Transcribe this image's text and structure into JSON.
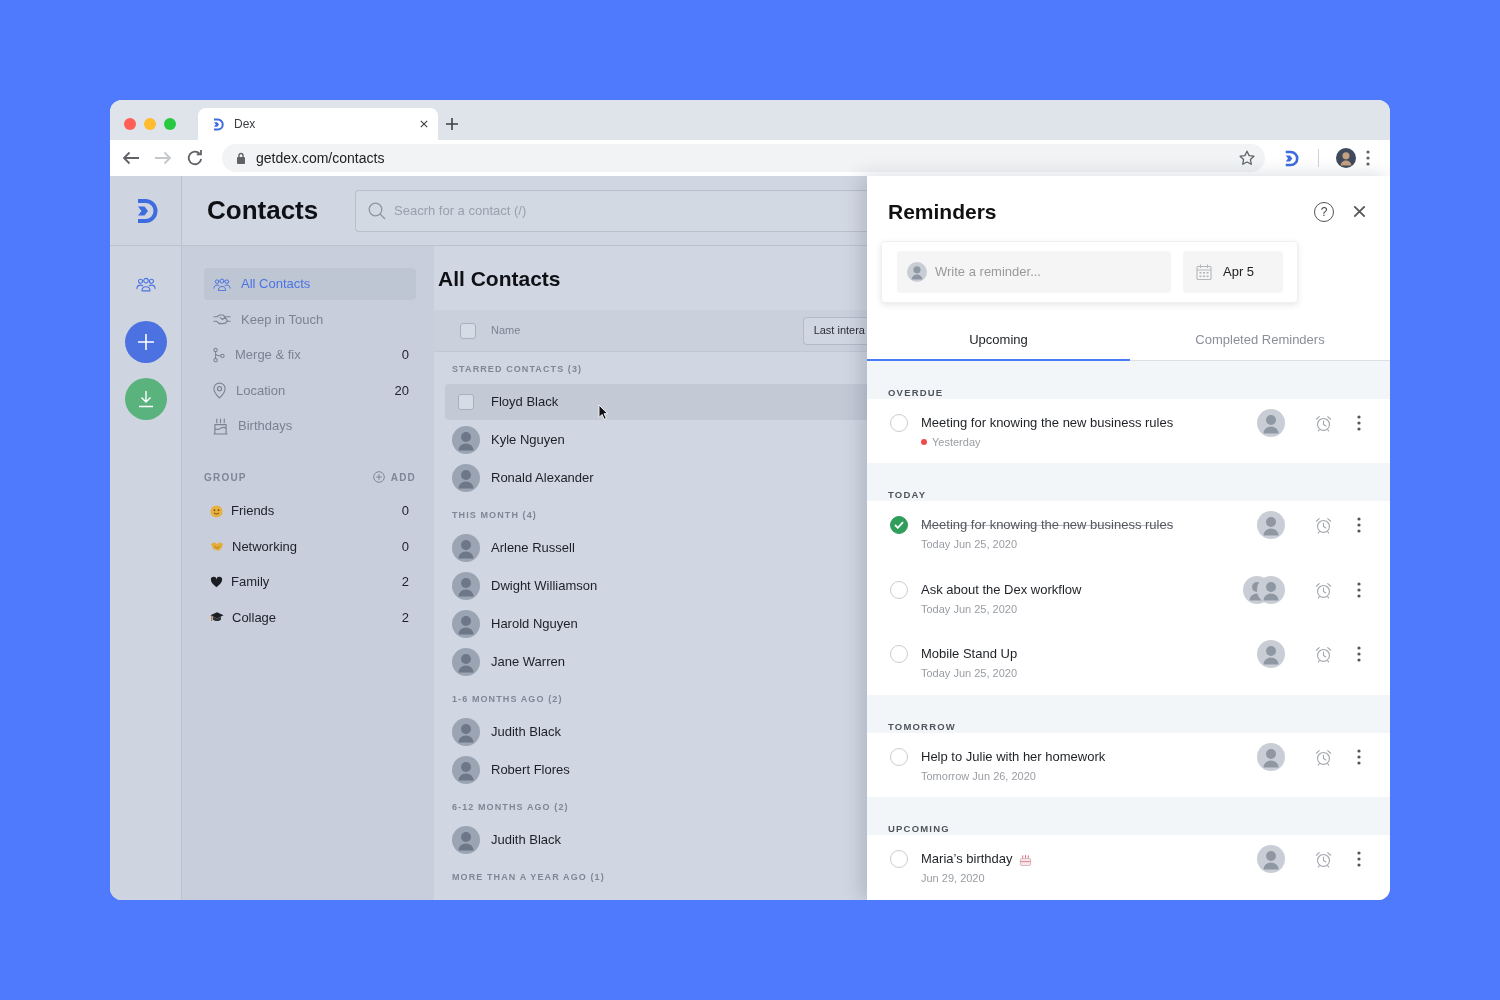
{
  "browser": {
    "tab_title": "Dex",
    "url": "getdex.com/contacts",
    "back_disabled": false,
    "forward_disabled": true
  },
  "header": {
    "title": "Contacts",
    "search": {
      "placeholder": "Seacrh for a contact (/)"
    }
  },
  "nav": {
    "items": [
      {
        "label": "All Contacts",
        "selected": true
      },
      {
        "label": "Keep in Touch",
        "selected": false
      },
      {
        "label": "Merge & fix",
        "count": "0",
        "selected": false
      },
      {
        "label": "Location",
        "count": "20",
        "selected": false
      },
      {
        "label": "Birthdays",
        "selected": false
      }
    ]
  },
  "groups": {
    "title": "GROUP",
    "add_label": "ADD",
    "items": [
      {
        "label": "Friends",
        "count": "0",
        "selected": false
      },
      {
        "label": "Networking",
        "count": "0",
        "selected": false
      },
      {
        "label": "Family",
        "count": "2",
        "selected": false
      },
      {
        "label": "Collage",
        "count": "2",
        "selected": false
      }
    ]
  },
  "contacts": {
    "title": "All Contacts",
    "select_all_checked": false,
    "name_column": "Name",
    "sort_button": "Last intera",
    "sections": [
      {
        "title": "STARRED CONTACTS (3)",
        "contacts": [
          {
            "name": "Floyd Black",
            "hovered": true,
            "checked": false
          },
          {
            "name": "Kyle Nguyen",
            "hovered": false,
            "checked": false
          },
          {
            "name": "Ronald Alexander",
            "hovered": false,
            "checked": false
          }
        ]
      },
      {
        "title": "THIS MONTH (4)",
        "contacts": [
          {
            "name": "Arlene Russell",
            "hovered": false,
            "checked": false
          },
          {
            "name": "Dwight Williamson",
            "hovered": false,
            "checked": false
          },
          {
            "name": "Harold Nguyen",
            "hovered": false,
            "checked": false
          },
          {
            "name": "Jane Warren",
            "hovered": false,
            "checked": false
          }
        ]
      },
      {
        "title": "1-6 MONTHS AGO (2)",
        "contacts": [
          {
            "name": "Judith Black",
            "hovered": false,
            "checked": false
          },
          {
            "name": "Robert Flores",
            "hovered": false,
            "checked": false
          }
        ]
      },
      {
        "title": "6-12 MONTHS AGO (2)",
        "contacts": [
          {
            "name": "Judith Black",
            "hovered": false,
            "checked": false
          }
        ]
      },
      {
        "title": "MORE THAN A YEAR AGO (1)"
      }
    ]
  },
  "reminders": {
    "title": "Reminders",
    "help": "?",
    "composer": {
      "placeholder": "Write a reminder...",
      "date": "Apr 5"
    },
    "tabs": [
      {
        "label": "Upcoming",
        "selected": true
      },
      {
        "label": "Completed Reminders",
        "selected": false
      }
    ],
    "groups": [
      {
        "title": "OVERDUE",
        "items": [
          {
            "kind": "task",
            "text": "Meeting for knowing the new business rules",
            "date": "Yesterday",
            "done": false,
            "overdue": true,
            "avatars": [
              {
                "kind": "photo"
              }
            ]
          }
        ]
      },
      {
        "title": "TODAY",
        "items": [
          {
            "kind": "task",
            "text": "Meeting for knowing the new business rules",
            "date": "Today Jun 25, 2020",
            "done": true,
            "overdue": false,
            "avatars": [
              {
                "kind": "photo"
              }
            ]
          },
          {
            "kind": "task",
            "text": "Ask about the Dex workflow",
            "date": "Today Jun 25, 2020",
            "done": false,
            "overdue": false,
            "avatars": [
              {
                "kind": "photo"
              },
              {
                "kind": "photo"
              }
            ]
          },
          {
            "kind": "task",
            "text": "Mobile Stand Up",
            "date": "Today Jun 25, 2020",
            "done": false,
            "overdue": false,
            "avatars": [
              {
                "kind": "photo"
              }
            ]
          }
        ]
      },
      {
        "title": "TOMORROW",
        "items": [
          {
            "kind": "task",
            "text": "Help to Julie with her homework",
            "date": "Tomorrow Jun 26, 2020",
            "done": false,
            "overdue": false,
            "avatars": [
              {
                "kind": "photo"
              }
            ]
          }
        ]
      },
      {
        "title": "UPCOMING",
        "items": [
          {
            "kind": "birthday",
            "text": "Maria’s birthday",
            "date": "Jun 29, 2020",
            "done": false,
            "overdue": false,
            "avatars": [
              {
                "kind": "photo"
              }
            ]
          }
        ]
      }
    ]
  }
}
